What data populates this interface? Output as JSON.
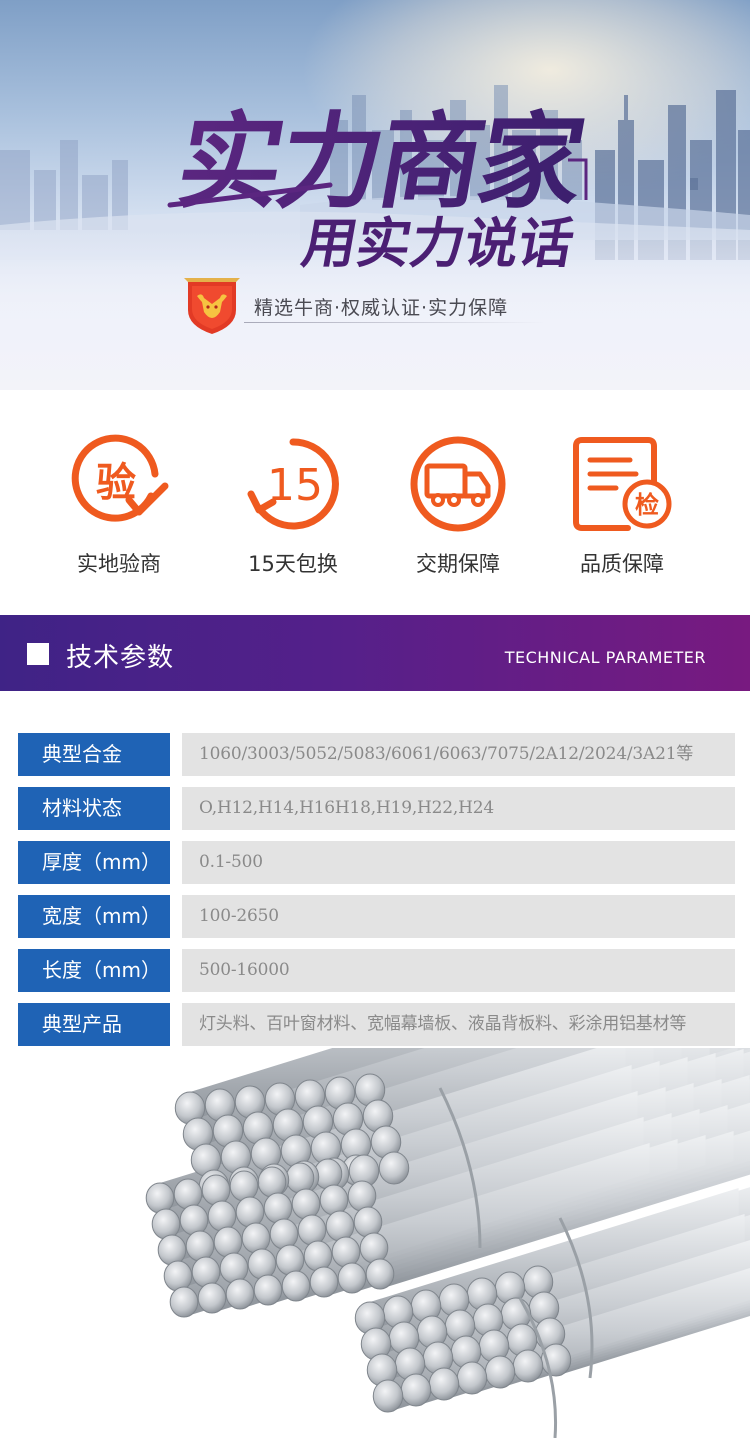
{
  "banner": {
    "headline_1": "实力商家",
    "headline_2": "用实力说话",
    "slogan": "精选牛商·权威认证·实力保障",
    "accent_purple": "#5a2a86",
    "accent_red": "#e23a25"
  },
  "features": [
    {
      "icon": "verify-icon",
      "glyph": "验",
      "label": "实地验商"
    },
    {
      "icon": "fifteen-days-icon",
      "glyph": "15",
      "label": "15天包换"
    },
    {
      "icon": "truck-icon",
      "glyph": "",
      "label": "交期保障"
    },
    {
      "icon": "inspection-doc-icon",
      "glyph": "检",
      "label": "品质保障"
    }
  ],
  "section": {
    "title": "技术参数",
    "subtitle": "TECHNICAL PARAMETER"
  },
  "specs": [
    {
      "label": "典型合金",
      "value": "1060/3003/5052/5083/6061/6063/7075/2A12/2024/3A21等"
    },
    {
      "label": "材料状态",
      "value": "O,H12,H14,H16H18,H19,H22,H24"
    },
    {
      "label": "厚度（mm）",
      "value": "0.1-500"
    },
    {
      "label": "宽度（mm）",
      "value": "100-2650"
    },
    {
      "label": "长度（mm）",
      "value": "500-16000"
    },
    {
      "label": "典型产品",
      "value": "灯头料、百叶窗材料、宽幅幕墙板、液晶背板料、彩涂用铝基材等"
    }
  ],
  "colors": {
    "feature_orange": "#ef5a1f",
    "spec_label_bg": "#1f63b5",
    "spec_value_bg": "#e3e3e3",
    "section_bar_start": "#3f2386",
    "section_bar_end": "#781a80"
  }
}
